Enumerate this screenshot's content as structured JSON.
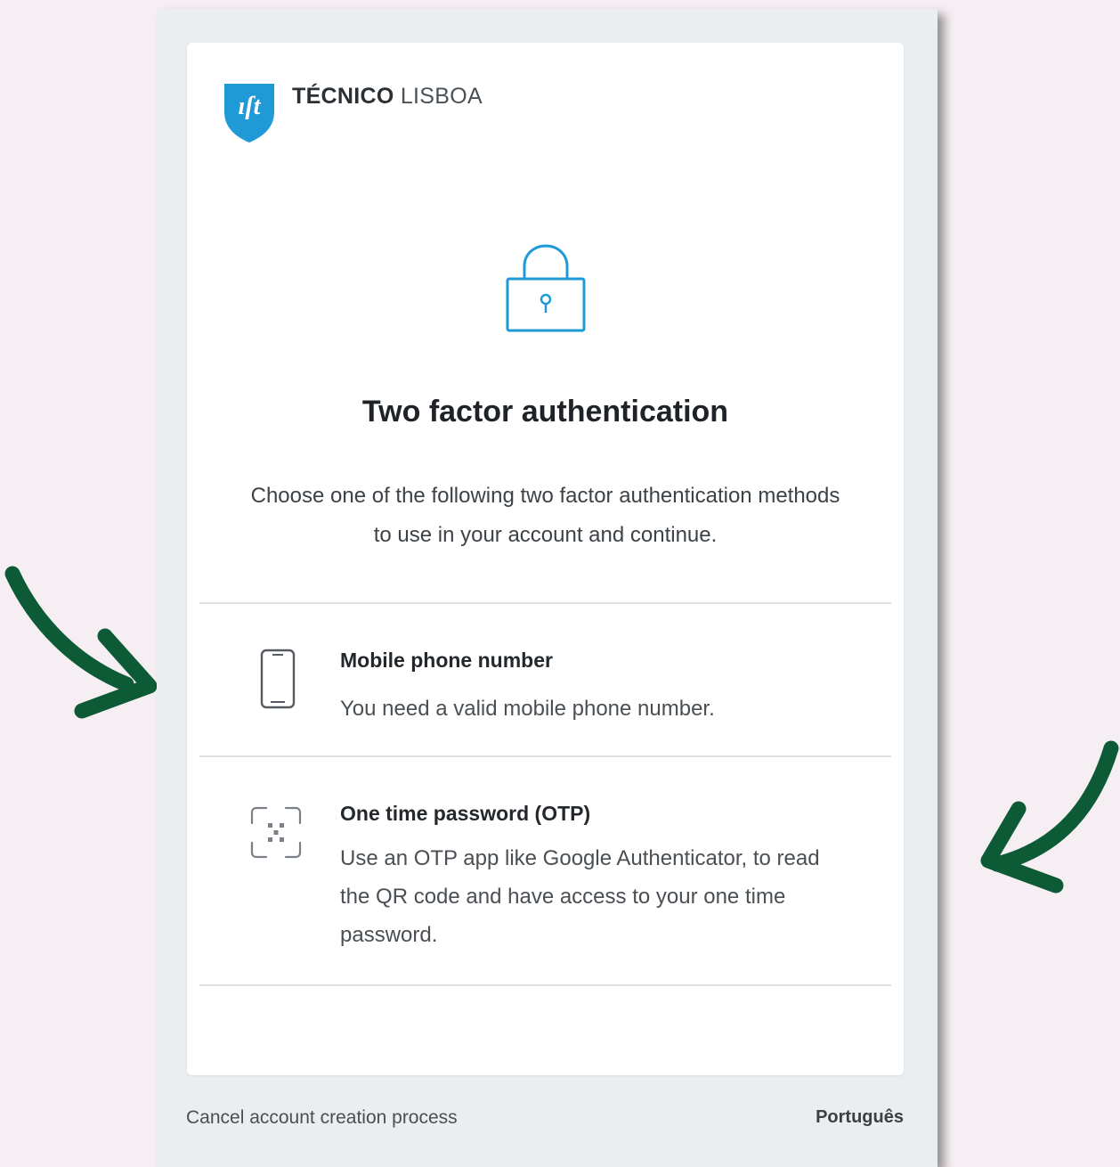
{
  "brand": {
    "logo_text": "IST",
    "name_bold": "TÉCNICO",
    "name_light": " LISBOA"
  },
  "page": {
    "title": "Two factor authentication",
    "subtitle": "Choose one of the following two factor authentication methods to use in your account and continue."
  },
  "options": [
    {
      "icon": "mobile-phone-icon",
      "title": "Mobile phone number",
      "description": "You need a valid mobile phone number."
    },
    {
      "icon": "qr-code-scan-icon",
      "title": "One time password (OTP)",
      "description": "Use an OTP app like Google Authenticator, to read the QR code and have access to your one time password."
    }
  ],
  "footer": {
    "cancel_label": "Cancel account creation process",
    "language_label": "Português"
  },
  "colors": {
    "accent": "#1f9ad6",
    "arrow": "#0d5a36",
    "background": "#f5eef2"
  }
}
